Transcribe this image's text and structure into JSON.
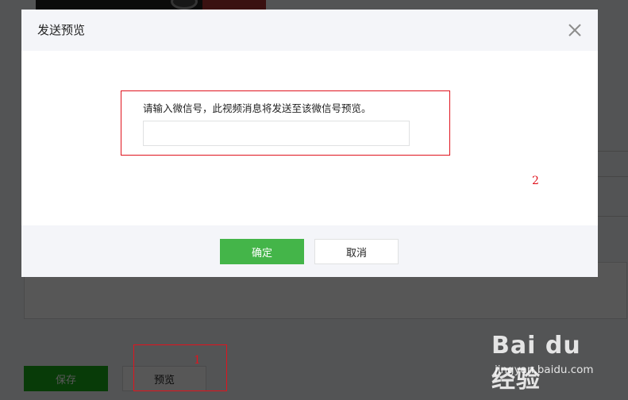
{
  "background": {
    "save_label": "保存",
    "preview_label": "预览"
  },
  "dialog": {
    "title": "发送预览",
    "close_icon": "close-icon",
    "tip": "请输入微信号，此视频消息将发送至该微信号预览。",
    "input_value": "",
    "input_placeholder": "",
    "confirm_label": "确定",
    "cancel_label": "取消"
  },
  "annotations": {
    "marker_1": "1",
    "marker_2": "2",
    "color": "#e0141e"
  },
  "watermark": {
    "logo": "Bai du 经验",
    "url": "jingyan.baidu.com"
  },
  "colors": {
    "primary_green": "#44b549",
    "header_bg": "#f4f5f9"
  }
}
